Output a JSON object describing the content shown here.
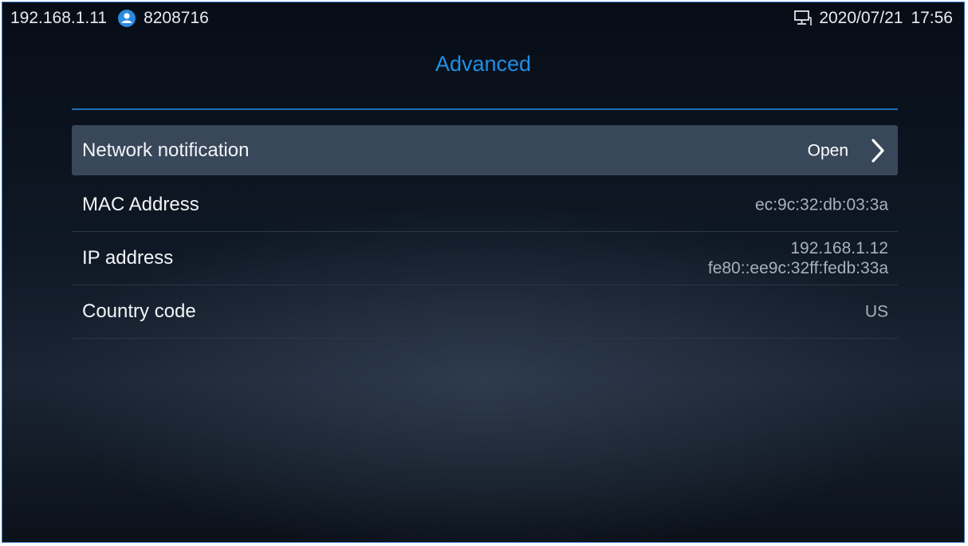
{
  "statusbar": {
    "ip": "192.168.1.11",
    "account": "8208716",
    "account_icon": "user-icon",
    "network_icon": "network-icon",
    "date": "2020/07/21",
    "time": "17:56"
  },
  "header": {
    "title": "Advanced"
  },
  "colors": {
    "accent": "#1e8fe6",
    "selected_row": "#39475a"
  },
  "settings": [
    {
      "label": "Network notification",
      "value": "Open",
      "icon": "chevron-right-icon"
    },
    {
      "label": "MAC Address",
      "value": "ec:9c:32:db:03:3a"
    },
    {
      "label": "IP address",
      "values": [
        "192.168.1.12",
        "fe80::ee9c:32ff:fedb:33a"
      ]
    },
    {
      "label": "Country code",
      "value": "US"
    }
  ]
}
